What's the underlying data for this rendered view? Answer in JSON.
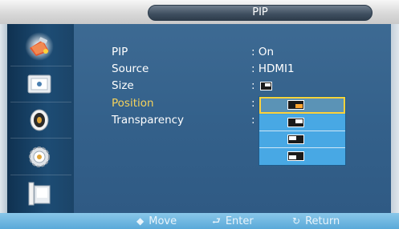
{
  "title": "PIP",
  "sidebar": {
    "items": [
      {
        "icon": "picture-settings-icon",
        "selected": true
      },
      {
        "icon": "display-icon",
        "selected": false
      },
      {
        "icon": "sound-icon",
        "selected": false
      },
      {
        "icon": "settings-gear-icon",
        "selected": false
      },
      {
        "icon": "input-source-icon",
        "selected": false
      }
    ]
  },
  "menu": {
    "rows": [
      {
        "label": "PIP",
        "value": ": On"
      },
      {
        "label": "Source",
        "value": ": HDMI1"
      },
      {
        "label": "Size",
        "value": ":"
      },
      {
        "label": "Position",
        "value": ":",
        "active": true
      },
      {
        "label": "Transparency",
        "value": ":"
      }
    ]
  },
  "position_options": [
    {
      "icon": "pip-position-bottom-right-icon",
      "selected": true
    },
    {
      "icon": "pip-position-top-right-icon",
      "selected": false
    },
    {
      "icon": "pip-position-top-left-icon",
      "selected": false
    },
    {
      "icon": "pip-position-bottom-left-icon",
      "selected": false
    }
  ],
  "footer": {
    "move": "Move",
    "enter": "Enter",
    "return": "Return"
  },
  "colors": {
    "active_text": "#f6d35c",
    "selection_border": "#ffd23a",
    "dropdown_bg": "#48a8e4"
  }
}
